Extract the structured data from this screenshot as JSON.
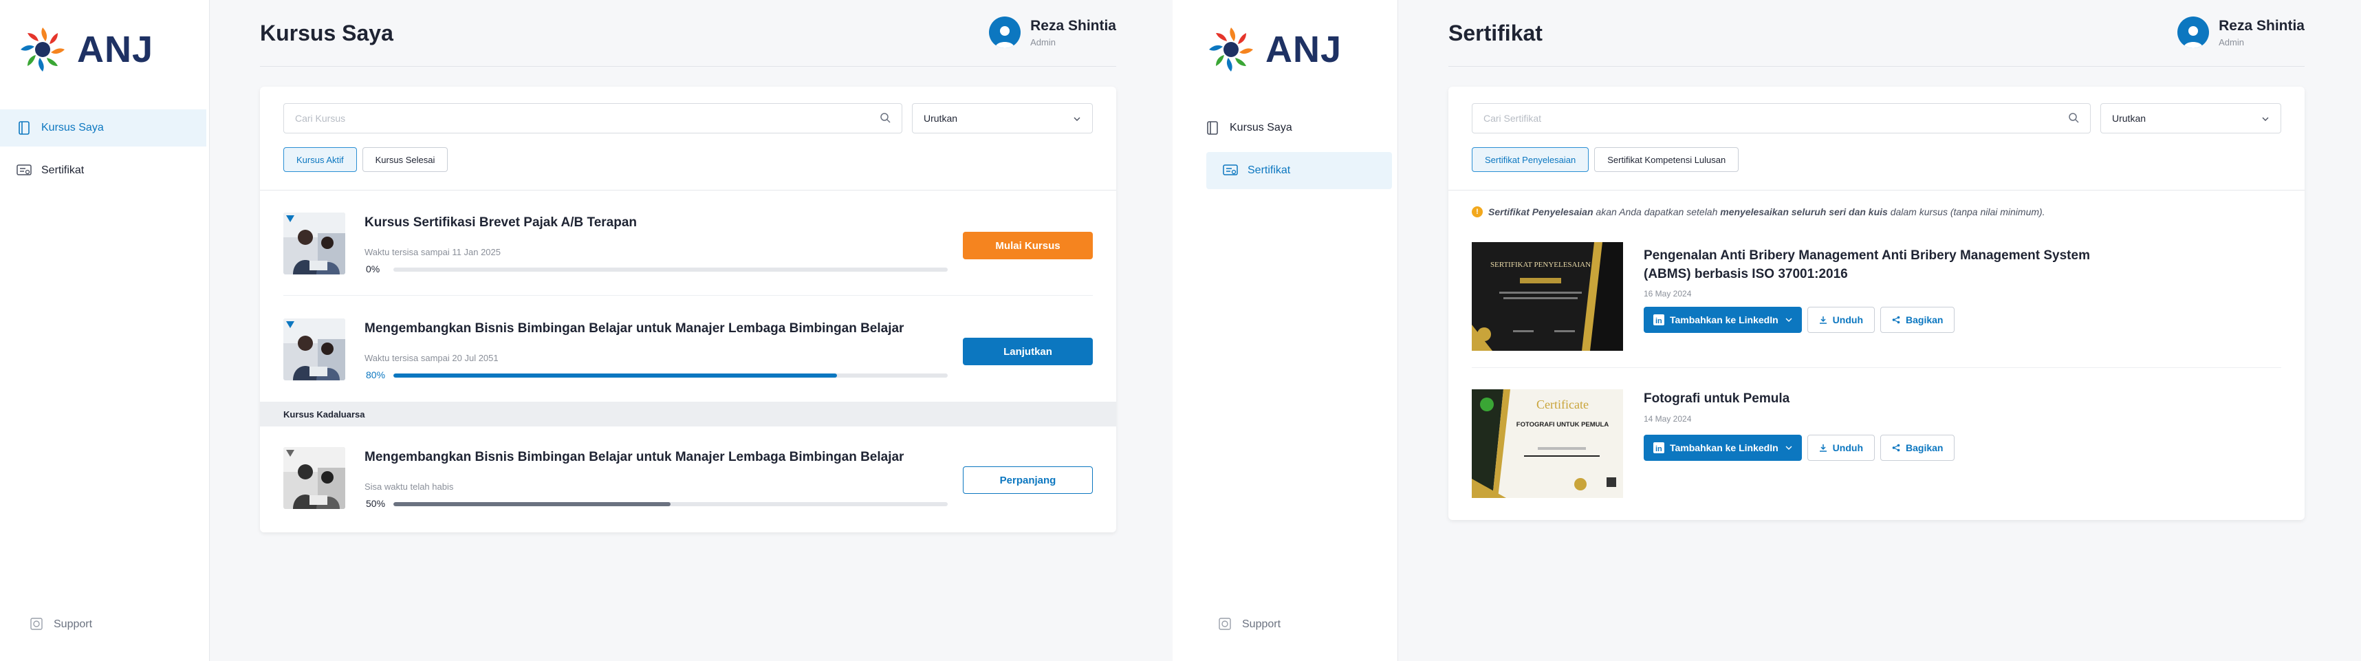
{
  "brand": {
    "name": "ANJ",
    "primary": "#0c77c0",
    "accent_orange": "#f5841f",
    "navy": "#1e3163"
  },
  "user": {
    "name": "Reza Shintia",
    "role": "Admin"
  },
  "nav": {
    "kursus_saya": "Kursus Saya",
    "sertifikat": "Sertifikat",
    "support": "Support"
  },
  "kursus": {
    "title": "Kursus Saya",
    "search_placeholder": "Cari Kursus",
    "sort_label": "Urutkan",
    "tabs": [
      "Kursus Aktif",
      "Kursus Selesai"
    ],
    "active_tab": "Kursus Aktif",
    "courses": [
      {
        "title": "Kursus Sertifikasi Brevet Pajak A/B Terapan",
        "subtitle": "Waktu tersisa sampai 11 Jan 2025",
        "progress_label": "0%",
        "progress": 0,
        "button": "Mulai Kursus"
      },
      {
        "title": "Mengembangkan Bisnis Bimbingan Belajar untuk Manajer Lembaga Bimbingan Belajar",
        "subtitle": "Waktu tersisa sampai 20 Jul 2051",
        "progress_label": "80%",
        "progress": 0.8,
        "button": "Lanjutkan"
      }
    ],
    "expired_header": "Kursus Kadaluarsa",
    "expired": [
      {
        "title": "Mengembangkan Bisnis Bimbingan Belajar untuk Manajer Lembaga Bimbingan Belajar",
        "subtitle": "Sisa waktu telah habis",
        "progress_label": "50%",
        "progress": 0.5,
        "button": "Perpanjang"
      }
    ]
  },
  "sertifikat": {
    "title": "Sertifikat",
    "search_placeholder": "Cari Sertifikat",
    "sort_label": "Urutkan",
    "tabs": [
      "Sertifikat Penyelesaian",
      "Sertifikat Kompetensi Lulusan"
    ],
    "active_tab": "Sertifikat Penyelesaian",
    "notice": {
      "lead": "Sertifikat Penyelesaian",
      "middle": " akan Anda dapatkan setelah ",
      "bold": "menyelesaikan seluruh seri dan kuis",
      "tail": " dalam kursus (tanpa nilai minimum)."
    },
    "items": [
      {
        "title": "Pengenalan Anti Bribery Management Anti Bribery Management System (ABMS) berbasis ISO 37001:2016",
        "date": "16 May 2024",
        "thumb_heading": "SERTIFIKAT PENYELESAIAN"
      },
      {
        "title": "Fotografi untuk Pemula",
        "date": "14 May 2024",
        "thumb_heading": "Certificate",
        "thumb_sub": "FOTOGRAFI UNTUK PEMULA"
      }
    ],
    "actions": {
      "linkedin": "Tambahkan ke LinkedIn",
      "download": "Unduh",
      "share": "Bagikan"
    }
  }
}
